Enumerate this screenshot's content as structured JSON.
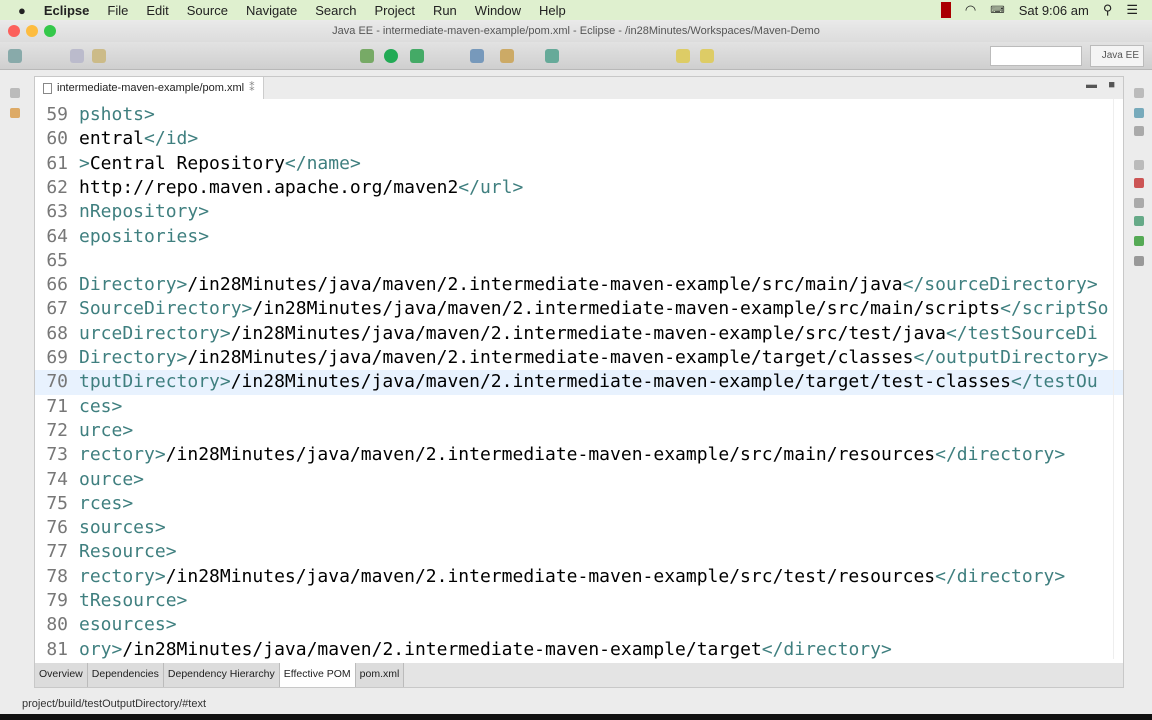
{
  "menubar": {
    "app": "Eclipse",
    "items": [
      "File",
      "Edit",
      "Source",
      "Navigate",
      "Search",
      "Project",
      "Run",
      "Window",
      "Help"
    ],
    "clock": "Sat 9:06 am"
  },
  "window": {
    "title": "Java EE - intermediate-maven-example/pom.xml - Eclipse - /in28Minutes/Workspaces/Maven-Demo"
  },
  "toolbar": {
    "perspective": "Java EE"
  },
  "editor": {
    "tab_label": "intermediate-maven-example/pom.xml",
    "tab_suffix": "⁑",
    "current_line": 70,
    "lines": [
      {
        "n": "59",
        "s": [
          [
            "pshots>",
            "tag"
          ]
        ]
      },
      {
        "n": "60",
        "s": [
          [
            "entral",
            "txt"
          ],
          [
            "</id>",
            "tag"
          ]
        ]
      },
      {
        "n": "61",
        "s": [
          [
            ">",
            "tag"
          ],
          [
            "Central Repository",
            "txt"
          ],
          [
            "</name>",
            "tag"
          ]
        ]
      },
      {
        "n": "62",
        "s": [
          [
            "http://repo.maven.apache.org/maven2",
            "txt"
          ],
          [
            "</url>",
            "tag"
          ]
        ]
      },
      {
        "n": "63",
        "s": [
          [
            "nRepository>",
            "tag"
          ]
        ]
      },
      {
        "n": "64",
        "s": [
          [
            "epositories>",
            "tag"
          ]
        ]
      },
      {
        "n": "65",
        "s": []
      },
      {
        "n": "66",
        "s": [
          [
            "Directory>",
            "tag"
          ],
          [
            "/in28Minutes/java/maven/2.intermediate-maven-example/src/main/java",
            "txt"
          ],
          [
            "</sourceDirectory>",
            "tag"
          ]
        ]
      },
      {
        "n": "67",
        "s": [
          [
            "SourceDirectory>",
            "tag"
          ],
          [
            "/in28Minutes/java/maven/2.intermediate-maven-example/src/main/scripts",
            "txt"
          ],
          [
            "</scriptSo",
            "tag"
          ]
        ]
      },
      {
        "n": "68",
        "s": [
          [
            "urceDirectory>",
            "tag"
          ],
          [
            "/in28Minutes/java/maven/2.intermediate-maven-example/src/test/java",
            "txt"
          ],
          [
            "</testSourceDi",
            "tag"
          ]
        ]
      },
      {
        "n": "69",
        "s": [
          [
            "Directory>",
            "tag"
          ],
          [
            "/in28Minutes/java/maven/2.intermediate-maven-example/target/classes",
            "txt"
          ],
          [
            "</outputDirectory>",
            "tag"
          ]
        ]
      },
      {
        "n": "70",
        "s": [
          [
            "tputDirectory>",
            "tag"
          ],
          [
            "/in28Minutes/java/maven/2.intermediate-maven-example/target/test-classes",
            "txt"
          ],
          [
            "</testOu",
            "tag"
          ]
        ]
      },
      {
        "n": "71",
        "s": [
          [
            "ces>",
            "tag"
          ]
        ]
      },
      {
        "n": "72",
        "s": [
          [
            "urce>",
            "tag"
          ]
        ]
      },
      {
        "n": "73",
        "s": [
          [
            "rectory>",
            "tag"
          ],
          [
            "/in28Minutes/java/maven/2.intermediate-maven-example/src/main/resources",
            "txt"
          ],
          [
            "</directory>",
            "tag"
          ]
        ]
      },
      {
        "n": "74",
        "s": [
          [
            "ource>",
            "tag"
          ]
        ]
      },
      {
        "n": "75",
        "s": [
          [
            "rces>",
            "tag"
          ]
        ]
      },
      {
        "n": "76",
        "s": [
          [
            "sources>",
            "tag"
          ]
        ]
      },
      {
        "n": "77",
        "s": [
          [
            "Resource>",
            "tag"
          ]
        ]
      },
      {
        "n": "78",
        "s": [
          [
            "rectory>",
            "tag"
          ],
          [
            "/in28Minutes/java/maven/2.intermediate-maven-example/src/test/resources",
            "txt"
          ],
          [
            "</directory>",
            "tag"
          ]
        ]
      },
      {
        "n": "79",
        "s": [
          [
            "tResource>",
            "tag"
          ]
        ]
      },
      {
        "n": "80",
        "s": [
          [
            "esources>",
            "tag"
          ]
        ]
      },
      {
        "n": "81",
        "s": [
          [
            "ory>",
            "tag"
          ],
          [
            "/in28Minutes/java/maven/2.intermediate-maven-example/target",
            "txt"
          ],
          [
            "</directory>",
            "tag"
          ]
        ]
      }
    ],
    "bottom_tabs": [
      "Overview",
      "Dependencies",
      "Dependency Hierarchy",
      "Effective POM",
      "pom.xml"
    ],
    "active_bottom_tab": "Effective POM"
  },
  "status": {
    "path": "project/build/testOutputDirectory/#text"
  }
}
